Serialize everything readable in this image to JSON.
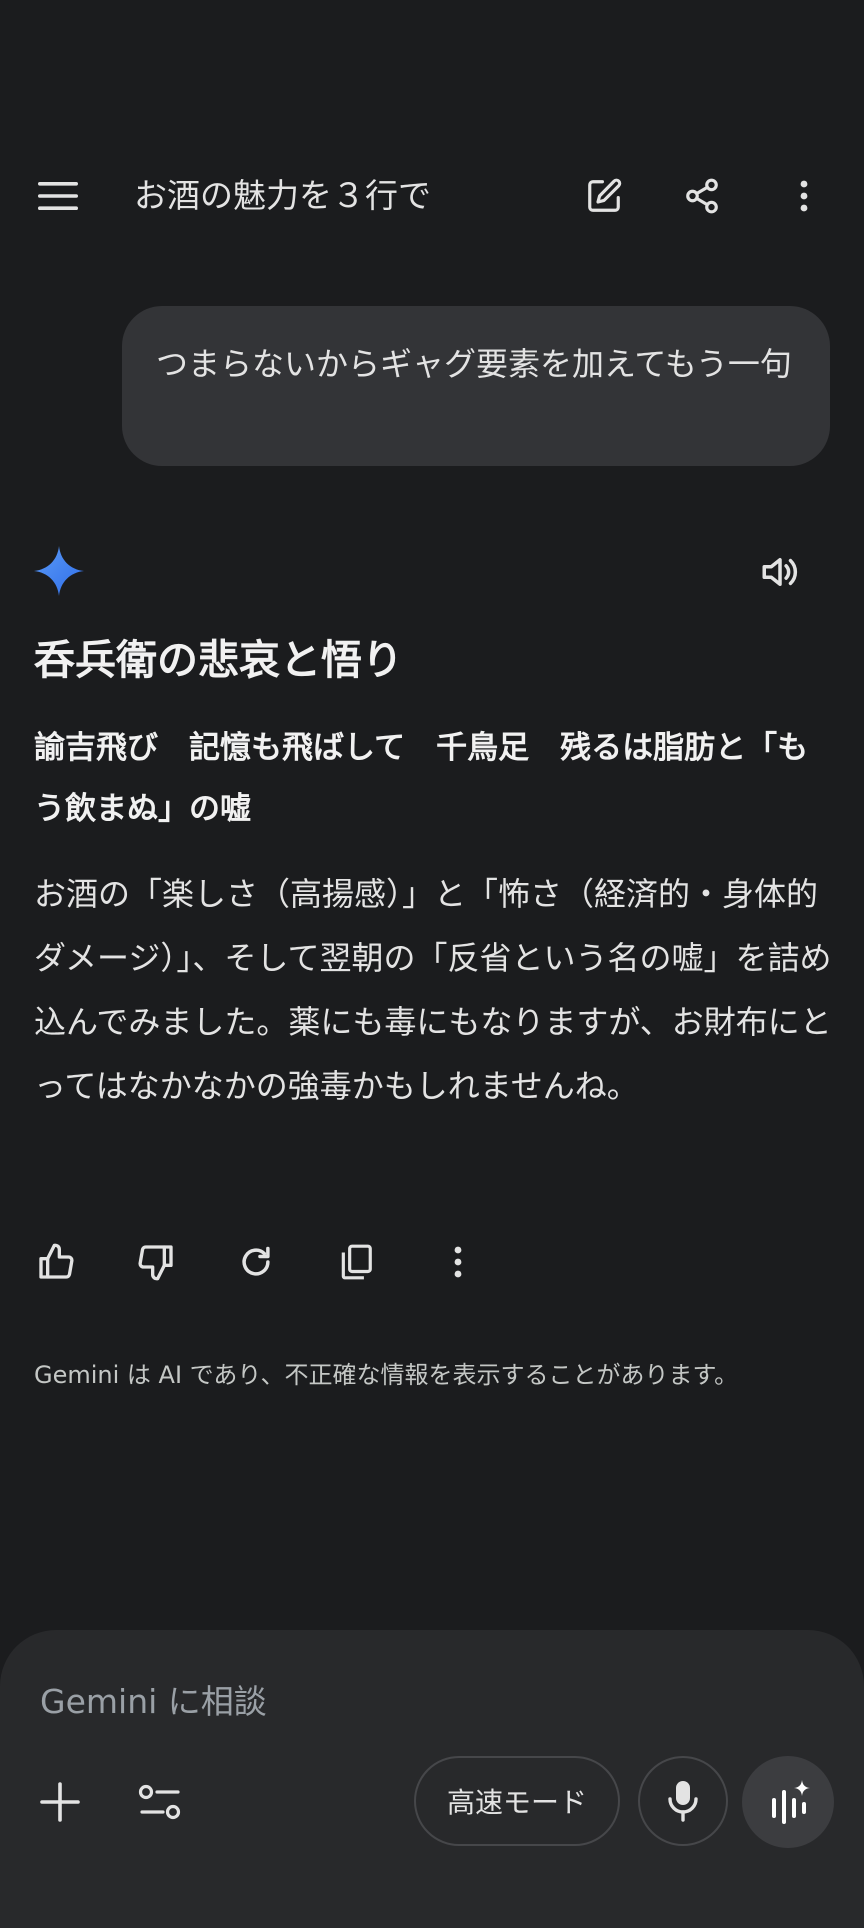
{
  "header": {
    "title": "お酒の魅力を３行で",
    "menu_icon": "hamburger-menu-icon",
    "edit_icon": "edit-icon",
    "share_icon": "share-icon",
    "more_icon": "more-vert-icon"
  },
  "user_message": {
    "text": "つまらないからギャグ要素を加えてもう一句"
  },
  "response": {
    "heading": "呑兵衛の悲哀と悟り",
    "verse": "諭吉飛び　記憶も飛ばして　千鳥足　残るは脂肪と「もう飲まぬ」の嘘",
    "body": "お酒の「楽しさ（高揚感）」と「怖さ（経済的・身体的ダメージ）」、そして翌朝の「反省という名の嘘」を詰め込んでみました。薬にも毒にもなりますが、お財布にとってはなかなかの強毒かもしれませんね。",
    "spark_icon": "gemini-spark-icon",
    "speaker_icon": "speaker-icon"
  },
  "actions": [
    "thumb-up-icon",
    "thumb-down-icon",
    "regenerate-icon",
    "copy-icon",
    "more-vert-icon"
  ],
  "disclaimer": "Gemini は AI であり、不正確な情報を表示することがあります。",
  "composer": {
    "placeholder": "Gemini に相談",
    "mode_label": "高速モード",
    "add_icon": "plus-icon",
    "tools_icon": "tools-icon",
    "mic_icon": "mic-icon",
    "live_icon": "gemini-live-icon"
  },
  "colors": {
    "background": "#1b1c1e",
    "bubble": "#333437",
    "composer": "#28292b",
    "accent_blue": "#4c8df6"
  }
}
